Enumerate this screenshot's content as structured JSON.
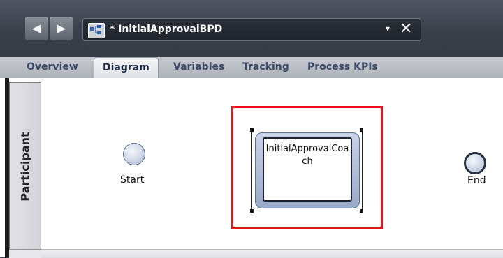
{
  "window": {
    "tab_title": "* InitialApprovalBPD",
    "dropdown_glyph": "▾",
    "close_glyph": "✕",
    "back_glyph": "◀",
    "forward_glyph": "▶"
  },
  "tabs": [
    {
      "label": "Overview",
      "active": false
    },
    {
      "label": "Diagram",
      "active": true
    },
    {
      "label": "Variables",
      "active": false
    },
    {
      "label": "Tracking",
      "active": false
    },
    {
      "label": "Process KPIs",
      "active": false
    }
  ],
  "diagram": {
    "lane_label": "Participant",
    "start_label": "Start",
    "end_label": "End",
    "activity_label": "InitialApprovalCoach"
  },
  "colors": {
    "highlight": "#e2151b",
    "titlebar": "#3b414c",
    "activity_fill": "#b4c0da"
  }
}
